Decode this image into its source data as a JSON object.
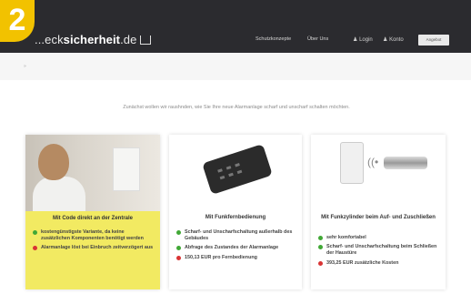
{
  "badge": "2",
  "header": {
    "logo_prefix": "...eck",
    "logo_bold": "sicherheit",
    "logo_suffix": ".de",
    "nav": [
      "Schutzkonzepte",
      "Über Uns"
    ],
    "user_links": [
      "Login",
      "Konto"
    ],
    "cta": "Angebot"
  },
  "breadcrumb": "»",
  "intro": "Zunächst wollen wir raushnden, wie Sie Ihre neue Alarmanlage scharf und unscharf schalten möchten.",
  "cards": [
    {
      "title": "Mit Code direkt an der Zentrale",
      "items": [
        {
          "type": "pro",
          "text": "kostengünstigste Variante, da keine zusätzlichen Komponenten benötigt werden"
        },
        {
          "type": "con",
          "text": "Alarmanlage löst bei Einbruch zeitverzögert aus"
        }
      ]
    },
    {
      "title": "Mit Funkfernbedienung",
      "items": [
        {
          "type": "pro",
          "text": "Scharf- und Unscharfschaltung außerhalb des Gebäudes"
        },
        {
          "type": "pro",
          "text": "Abfrage des Zustandes der Alarmanlage"
        },
        {
          "type": "con",
          "text": "150,13 EUR pro Fernbedienung"
        }
      ]
    },
    {
      "title": "Mit Funkzylinder beim Auf- und Zuschließen",
      "items": [
        {
          "type": "pro",
          "text": "sehr komfortabel"
        },
        {
          "type": "pro",
          "text": "Scharf- und Unscharfschaltung beim Schließen der Haustüre"
        },
        {
          "type": "con",
          "text": "393,25 EUR zusätzliche Kosten"
        }
      ]
    }
  ],
  "colors": {
    "header_bg": "#2b2b2f",
    "badge": "#f2c200",
    "highlight_card": "#f2ea62",
    "pro": "#41a836",
    "con": "#d93434"
  }
}
